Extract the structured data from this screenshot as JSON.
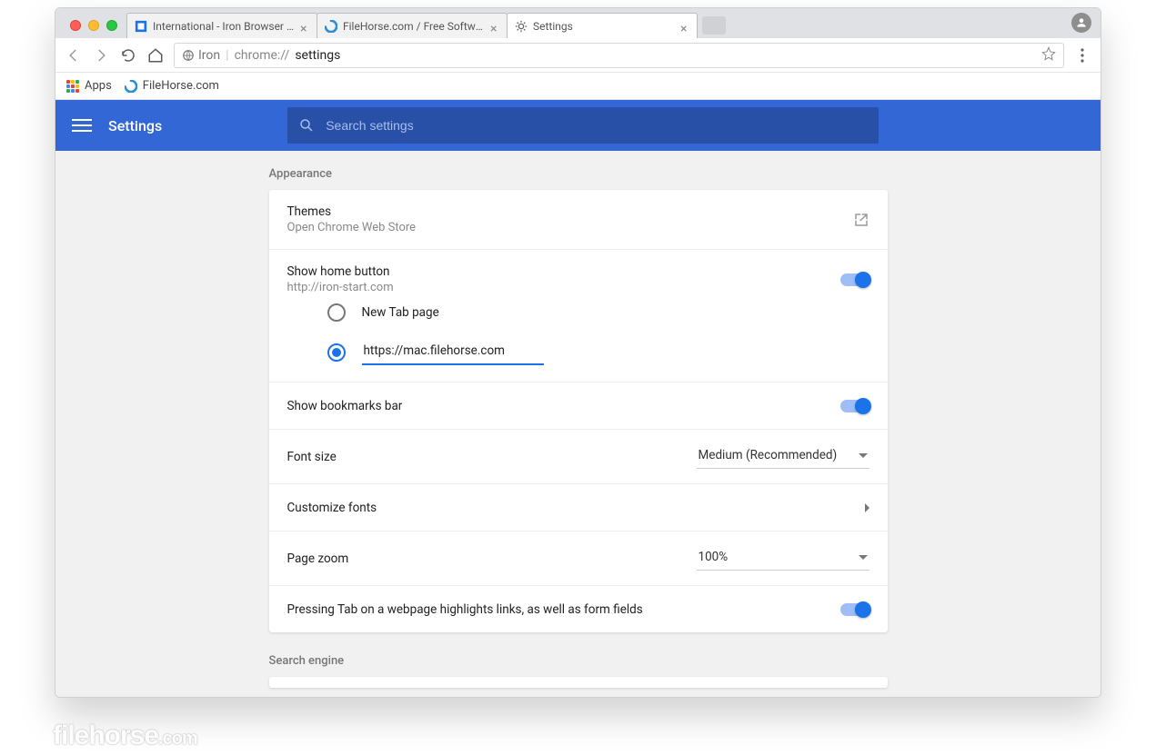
{
  "tabs": [
    {
      "title": "International - Iron Browser - s",
      "favicon": "iron"
    },
    {
      "title": "FileHorse.com / Free Software",
      "favicon": "filehorse"
    },
    {
      "title": "Settings",
      "favicon": "gear",
      "active": true
    }
  ],
  "omnibox": {
    "secure_label": "Iron",
    "url_scheme": "chrome://",
    "url_path": "settings"
  },
  "bookmarks_bar": {
    "apps_label": "Apps",
    "items": [
      {
        "label": "FileHorse.com"
      }
    ]
  },
  "settings": {
    "header_title": "Settings",
    "search_placeholder": "Search settings",
    "sections": {
      "appearance": {
        "label": "Appearance",
        "themes": {
          "title": "Themes",
          "subtitle": "Open Chrome Web Store"
        },
        "home_button": {
          "title": "Show home button",
          "subtitle": "http://iron-start.com",
          "enabled": true,
          "options": {
            "new_tab_label": "New Tab page",
            "custom_url": "https://mac.filehorse.com",
            "selected": "custom"
          }
        },
        "bookmarks_bar": {
          "title": "Show bookmarks bar",
          "enabled": true
        },
        "font_size": {
          "title": "Font size",
          "value": "Medium (Recommended)"
        },
        "customize_fonts": {
          "title": "Customize fonts"
        },
        "page_zoom": {
          "title": "Page zoom",
          "value": "100%"
        },
        "tab_highlights": {
          "title": "Pressing Tab on a webpage highlights links, as well as form fields",
          "enabled": true
        }
      },
      "search_engine": {
        "label": "Search engine"
      }
    }
  },
  "watermark": {
    "brand": "filehorse",
    "tld": ".com"
  }
}
